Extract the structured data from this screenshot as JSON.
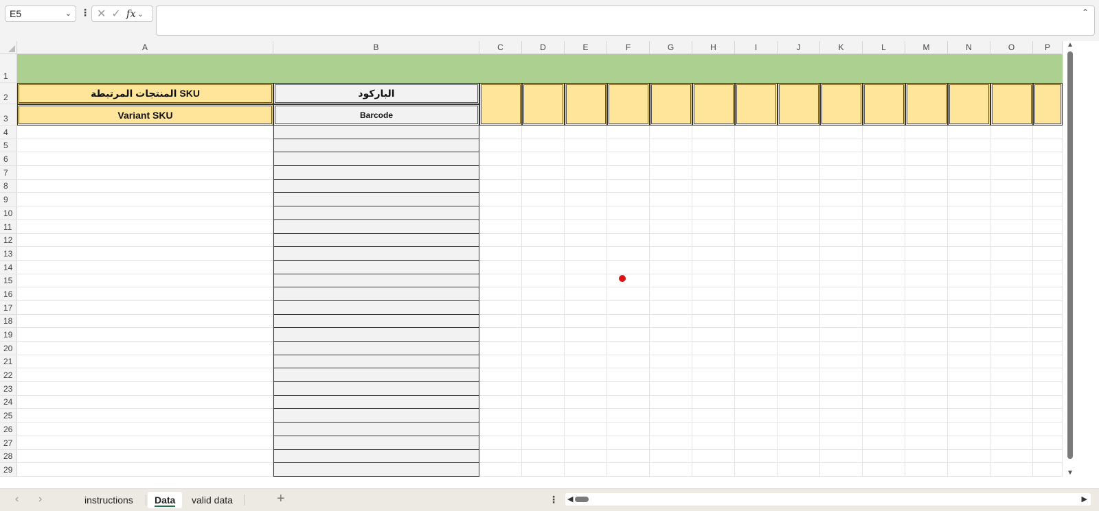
{
  "formula_bar": {
    "name_box": "E5",
    "formula": ""
  },
  "columns": [
    "A",
    "B",
    "C",
    "D",
    "E",
    "F",
    "G",
    "H",
    "I",
    "J",
    "K",
    "L",
    "M",
    "N",
    "O",
    "P"
  ],
  "rows": [
    "1",
    "2",
    "3",
    "4",
    "5",
    "6",
    "7",
    "8",
    "9",
    "10",
    "11",
    "12",
    "13",
    "14",
    "15",
    "16",
    "17",
    "18",
    "19",
    "20",
    "21",
    "22",
    "23",
    "24",
    "25",
    "26",
    "27",
    "28",
    "29"
  ],
  "cells": {
    "A2": "المنتجات المرتبطة SKU",
    "B2": "الباركود",
    "A3": "Variant SKU",
    "B3": "Barcode"
  },
  "sheets": {
    "tabs": [
      "instructions",
      "Data",
      "valid data"
    ],
    "active": "Data"
  },
  "colors": {
    "title_row": "#acd08f",
    "header_fill": "#ffe599",
    "barcode_fill": "#f2f2f2",
    "active_tab_underline": "#217346",
    "marker": "#d81414"
  }
}
